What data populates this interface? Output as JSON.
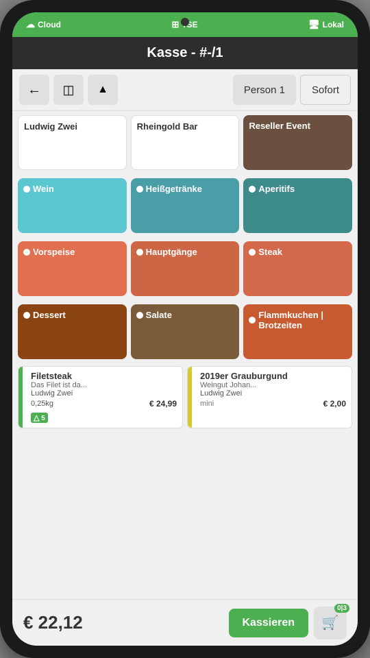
{
  "statusBar": {
    "items": [
      {
        "icon": "☁",
        "label": "Cloud"
      },
      {
        "icon": "⊞",
        "label": "TSE"
      },
      {
        "icon": "🖥",
        "label": "Lokal"
      }
    ]
  },
  "header": {
    "title": "Kasse - #-/1"
  },
  "toolbar": {
    "backLabel": "←",
    "layoutLabel": "⊟",
    "upLabel": "▲",
    "person1Label": "Person 1",
    "sofortLabel": "Sofort"
  },
  "topCards": [
    {
      "id": "ludwig-zwei",
      "label": "Ludwig Zwei",
      "colorClass": "card-white",
      "dark": true
    },
    {
      "id": "rheingold-bar",
      "label": "Rheingold Bar",
      "colorClass": "card-white",
      "dark": true
    },
    {
      "id": "reseller-event",
      "label": "Reseller Event",
      "colorClass": "card-reseller",
      "dark": false
    }
  ],
  "categories": [
    {
      "id": "wein",
      "label": "Wein",
      "colorClass": "card-cyan"
    },
    {
      "id": "heissgetranke",
      "label": "Heißgetränke",
      "colorClass": "card-teal"
    },
    {
      "id": "aperitifs",
      "label": "Aperitifs",
      "colorClass": "card-teal2"
    },
    {
      "id": "vorspeise",
      "label": "Vorspeise",
      "colorClass": "card-salmon"
    },
    {
      "id": "hauptgange",
      "label": "Hauptgänge",
      "colorClass": "card-salmon2"
    },
    {
      "id": "steak",
      "label": "Steak",
      "colorClass": "card-orange"
    },
    {
      "id": "dessert",
      "label": "Dessert",
      "colorClass": "card-brown"
    },
    {
      "id": "salate",
      "label": "Salate",
      "colorClass": "card-brown2"
    },
    {
      "id": "flammkuchen",
      "label": "Flammkuchen | Brotzeiten",
      "colorClass": "card-burnt"
    }
  ],
  "orderItems": [
    {
      "id": "filetsteak",
      "tagColor": "tag-green",
      "title": "Filetsteak",
      "desc": "Das Filet ist da...",
      "location": "Ludwig Zwei",
      "weight": "0,25kg",
      "price": "€ 24,99",
      "badge": "5"
    },
    {
      "id": "grauburgund",
      "tagColor": "tag-yellow",
      "title": "2019er Grauburgund",
      "desc": "Weingut Johan...",
      "location": "Ludwig Zwei",
      "size": "mini",
      "price": "€ 2,00",
      "badge": ""
    }
  ],
  "bottomBar": {
    "total": "€ 22,12",
    "kassierenLabel": "Kassieren",
    "cartBadge": "0|3"
  }
}
